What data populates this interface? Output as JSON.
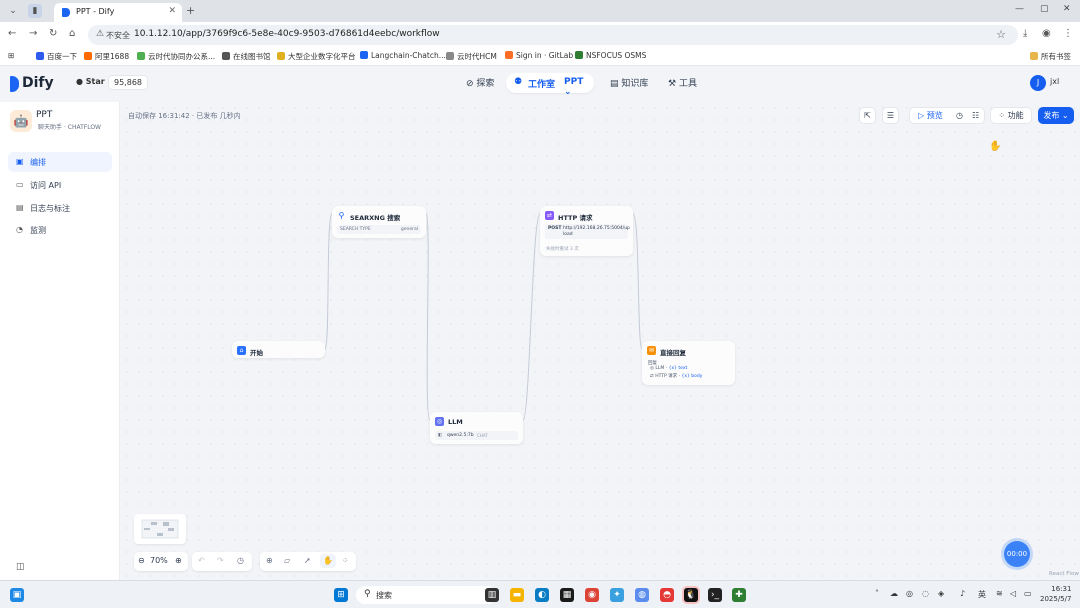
{
  "browser": {
    "tab_title": "PPT - Dify",
    "new_tab": "+",
    "insecure_label": "不安全",
    "url": "10.1.12.10/app/3769f9c6-5e8e-40c9-9503-d76861d4eebc/workflow",
    "bookmarks": [
      {
        "label": "百度一下",
        "color": "#2f5bea"
      },
      {
        "label": "阿里1688",
        "color": "#ff6a00"
      },
      {
        "label": "云时代协同办公系...",
        "color": "#4caf50"
      },
      {
        "label": "在线图书馆",
        "color": "#555555"
      },
      {
        "label": "大型企业数字化平台",
        "color": "#e0b020"
      },
      {
        "label": "Langchain-Chatch...",
        "color": "#1c64f2"
      },
      {
        "label": "云时代HCM",
        "color": "#888888"
      },
      {
        "label": "Sign in · GitLab",
        "color": "#fc6d26"
      },
      {
        "label": "NSFOCUS OSMS",
        "color": "#2e7d32"
      }
    ],
    "all_bookmarks": "所有书签"
  },
  "header": {
    "brand": "Dify",
    "github_label": "Star",
    "github_count": "95,868",
    "nav": {
      "explore": "探索",
      "studio": "工作室",
      "studio_app": "PPT",
      "knowledge": "知识库",
      "tools": "工具"
    },
    "user_initial": "J",
    "user_name": "jxl"
  },
  "sidebar": {
    "app_name": "PPT",
    "app_mode_a": "聊天助手",
    "app_mode_b": "CHATFLOW",
    "items": [
      {
        "label": "编排",
        "icon": "layout-icon",
        "active": true
      },
      {
        "label": "访问 API",
        "icon": "terminal-icon",
        "active": false
      },
      {
        "label": "日志与标注",
        "icon": "file-text-icon",
        "active": false
      },
      {
        "label": "监测",
        "icon": "monitor-icon",
        "active": false
      }
    ]
  },
  "toolbar": {
    "autosave": "自动保存 16:31:42 · 已发布 几秒内",
    "preview": "预览",
    "features": "功能",
    "publish": "发布"
  },
  "nodes": {
    "start": {
      "title": "开始",
      "color": "#2970ff"
    },
    "searxng": {
      "title": "SEARXNG 搜索",
      "param_label": "SEARCH TYPE",
      "param_value": "general"
    },
    "http": {
      "title": "HTTP 请求",
      "method": "POST",
      "url": "http://192.168.26.75:5004/upload",
      "retry": "失败时重试 3 次",
      "color": "#875bf7"
    },
    "answer": {
      "title": "直接回复",
      "content_label": "回复",
      "ref1_node": "LLM",
      "ref1_var": "{x} text",
      "ref2_node": "HTTP 请求",
      "ref2_var": "{x} body",
      "color": "#f79009"
    },
    "llm": {
      "title": "LLM",
      "model": "qwen2.5:7b",
      "mode": "CHAT",
      "color": "#6172f3"
    }
  },
  "canvas_controls": {
    "zoom": "70%",
    "timer": "00:00",
    "attribution": "React Flow"
  },
  "taskbar": {
    "search": "搜索",
    "lang": "英",
    "time": "16:31",
    "date": "2025/5/7"
  }
}
